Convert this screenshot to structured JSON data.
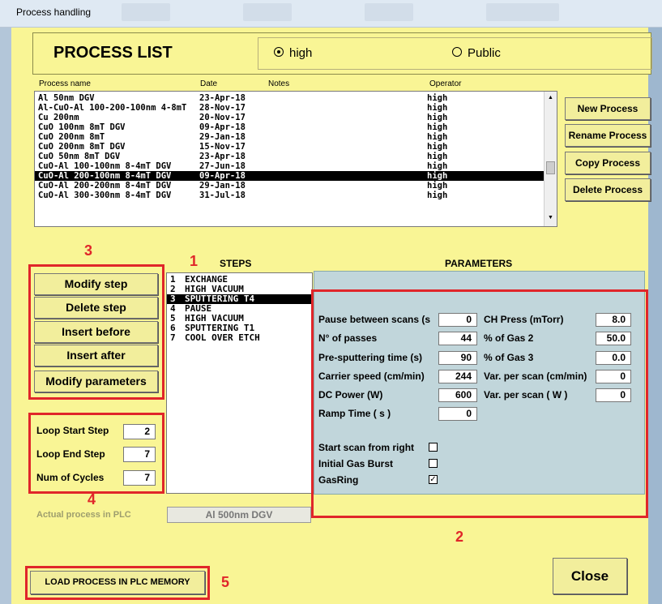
{
  "window_title": "Process handling",
  "header": {
    "title": "PROCESS LIST",
    "radio_high": "high",
    "radio_public": "Public",
    "selected": "high"
  },
  "process_list": {
    "columns": {
      "name": "Process name",
      "date": "Date",
      "notes": "Notes",
      "operator": "Operator"
    },
    "rows": [
      {
        "name": "Al 50nm DGV",
        "date": "23-Apr-18",
        "notes": "",
        "operator": "high"
      },
      {
        "name": "Al-CuO-Al 100-200-100nm 4-8mT",
        "date": "28-Nov-17",
        "notes": "",
        "operator": "high"
      },
      {
        "name": "Cu 200nm",
        "date": "20-Nov-17",
        "notes": "",
        "operator": "high"
      },
      {
        "name": "CuO 100nm 8mT DGV",
        "date": "09-Apr-18",
        "notes": "",
        "operator": "high"
      },
      {
        "name": "CuO 200nm 8mT",
        "date": "29-Jan-18",
        "notes": "",
        "operator": "high"
      },
      {
        "name": "CuO 200nm 8mT DGV",
        "date": "15-Nov-17",
        "notes": "",
        "operator": "high"
      },
      {
        "name": "CuO 50nm 8mT DGV",
        "date": "23-Apr-18",
        "notes": "",
        "operator": "high"
      },
      {
        "name": "CuO-Al 100-100nm 8-4mT DGV",
        "date": "27-Jun-18",
        "notes": "",
        "operator": "high"
      },
      {
        "name": "CuO-Al 200-100nm 8-4mT DGV",
        "date": "09-Apr-18",
        "notes": "",
        "operator": "high"
      },
      {
        "name": "CuO-Al 200-200nm 8-4mT DGV",
        "date": "29-Jan-18",
        "notes": "",
        "operator": "high"
      },
      {
        "name": "CuO-Al 300-300nm 8-4mT DGV",
        "date": "31-Jul-18",
        "notes": "",
        "operator": "high"
      }
    ],
    "selected_index": 8
  },
  "process_buttons": {
    "new": "New Process",
    "rename": "Rename Process",
    "copy": "Copy Process",
    "delete": "Delete Process"
  },
  "annotations": {
    "n1": "1",
    "n2": "2",
    "n3": "3",
    "n4": "4",
    "n5": "5"
  },
  "steps": {
    "header": "STEPS",
    "items": [
      {
        "num": "1",
        "name": "EXCHANGE"
      },
      {
        "num": "2",
        "name": "HIGH VACUUM"
      },
      {
        "num": "3",
        "name": "SPUTTERING T4"
      },
      {
        "num": "4",
        "name": "PAUSE"
      },
      {
        "num": "5",
        "name": "HIGH VACUUM"
      },
      {
        "num": "6",
        "name": "SPUTTERING T1"
      },
      {
        "num": "7",
        "name": "COOL OVER ETCH"
      }
    ],
    "selected_index": 2
  },
  "step_buttons": {
    "modify_step": "Modify step",
    "delete_step": "Delete step",
    "insert_before": "Insert before",
    "insert_after": "Insert after",
    "modify_parameters": "Modify parameters"
  },
  "loop": {
    "start_label": "Loop Start Step",
    "start_value": "2",
    "end_label": "Loop End Step",
    "end_value": "7",
    "cycles_label": "Num of Cycles",
    "cycles_value": "7"
  },
  "parameters": {
    "header": "PARAMETERS",
    "left": [
      {
        "label": "Pause between scans (s",
        "value": "0"
      },
      {
        "label": "N° of passes",
        "value": "44"
      },
      {
        "label": "Pre-sputtering time (s)",
        "value": "90"
      },
      {
        "label": "Carrier speed (cm/min)",
        "value": "244"
      },
      {
        "label": "DC Power (W)",
        "value": "600"
      },
      {
        "label": "Ramp Time ( s )",
        "value": "0"
      }
    ],
    "right": [
      {
        "label": "CH Press (mTorr)",
        "value": "8.0"
      },
      {
        "label": "% of Gas 2",
        "value": "50.0"
      },
      {
        "label": "% of Gas 3",
        "value": "0.0"
      },
      {
        "label": "Var. per scan (cm/min)",
        "value": "0"
      },
      {
        "label": "Var. per scan ( W )",
        "value": "0"
      }
    ],
    "checks": [
      {
        "label": "Start scan from right",
        "checked": false,
        "mark": ""
      },
      {
        "label": "Initial Gas Burst",
        "checked": false,
        "mark": ""
      },
      {
        "label": "GasRing",
        "checked": true,
        "mark": "✓"
      }
    ]
  },
  "plc": {
    "label": "Actual process in PLC",
    "value": "Al 500nm DGV",
    "load_button": "LOAD  PROCESS IN PLC MEMORY"
  },
  "close_button": "Close",
  "colors": {
    "panel": "#f9f595",
    "params": "#c1d6db",
    "highlight": "#e0262a"
  }
}
